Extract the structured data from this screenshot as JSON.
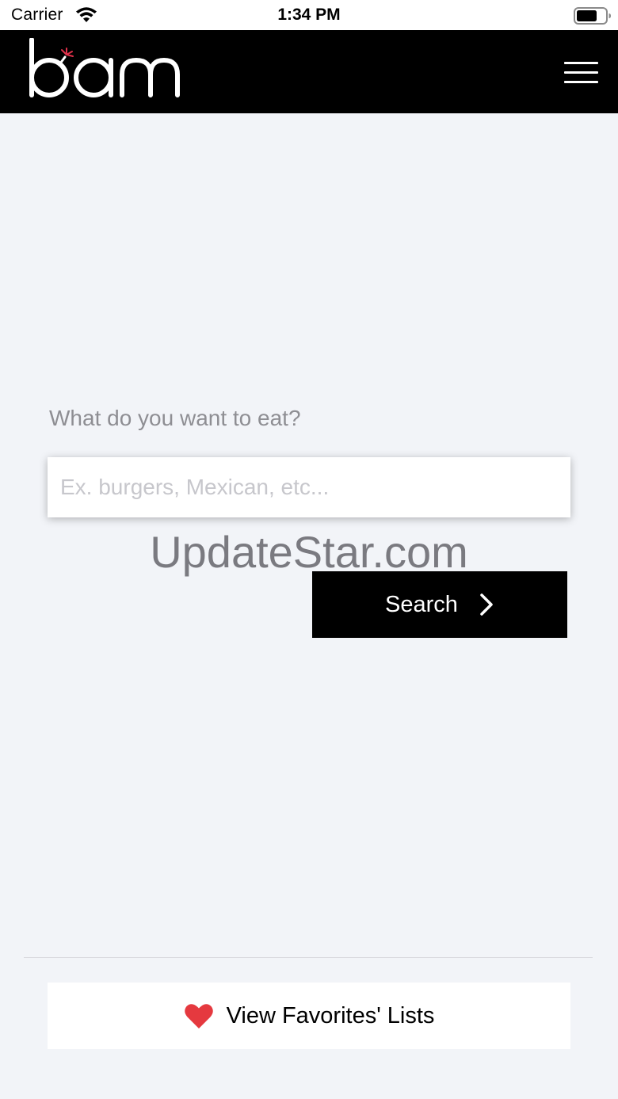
{
  "status_bar": {
    "carrier": "Carrier",
    "time": "1:34 PM"
  },
  "header": {
    "logo_text": "bam",
    "logo_accent_color": "#e0314b",
    "menu_icon": "hamburger-menu-icon"
  },
  "main": {
    "prompt": "What do you want to eat?",
    "search_placeholder": "Ex. burgers, Mexican, etc...",
    "search_value": "",
    "watermark": "UpdateStar.com",
    "search_button_label": "Search",
    "search_button_icon": "chevron-right-icon"
  },
  "footer": {
    "favorites_label": "View Favorites' Lists",
    "favorites_icon": "heart-icon",
    "heart_color": "#e5393f"
  }
}
